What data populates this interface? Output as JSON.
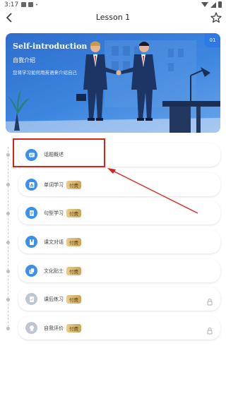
{
  "status_bar": {
    "time": "3:17"
  },
  "header": {
    "title": "Lesson 1",
    "back_icon": "chevron-left-icon",
    "star_icon": "star-outline-icon"
  },
  "banner": {
    "title": "Self-introduction",
    "subtitle": "自我介绍",
    "description": "您将学习如何用英语来介绍自己",
    "badge": "01"
  },
  "lessons": [
    {
      "label": "话题概述",
      "paid": "",
      "icon": "chat-icon",
      "locked": false,
      "enabled": true
    },
    {
      "label": "单词学习",
      "paid": "付费",
      "icon": "letter-a-icon",
      "locked": false,
      "enabled": true
    },
    {
      "label": "句型学习",
      "paid": "付费",
      "icon": "document-icon",
      "locked": false,
      "enabled": true
    },
    {
      "label": "课文对话",
      "paid": "付费",
      "icon": "book-icon",
      "locked": false,
      "enabled": true
    },
    {
      "label": "文化贴士",
      "paid": "付费",
      "icon": "cards-icon",
      "locked": false,
      "enabled": true
    },
    {
      "label": "课后练习",
      "paid": "付费",
      "icon": "checklist-icon",
      "locked": true,
      "enabled": false
    },
    {
      "label": "自我评价",
      "paid": "付费",
      "icon": "badge-icon",
      "locked": true,
      "enabled": false
    }
  ],
  "colors": {
    "accent": "#3d8fec",
    "annotation": "#d8201c",
    "paid_gold": "#d4b06a"
  }
}
